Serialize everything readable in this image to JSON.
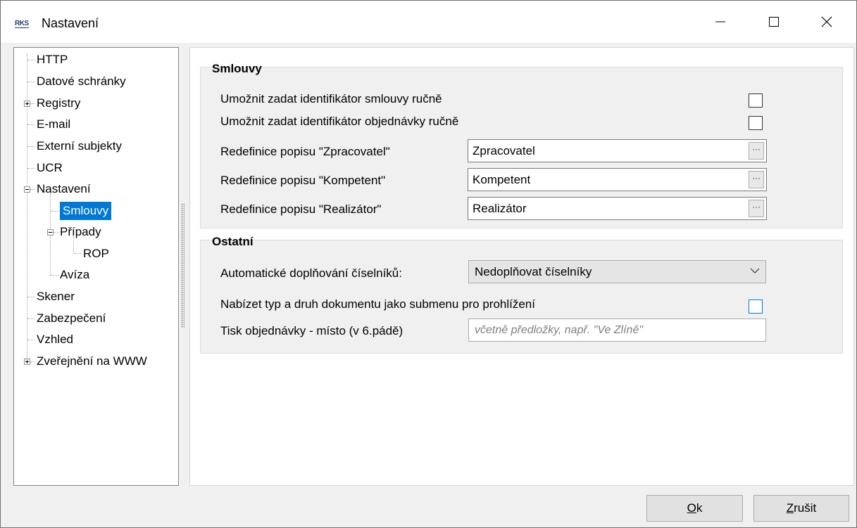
{
  "window": {
    "logo_text": "RKS",
    "title": "Nastavení",
    "minimize_label": "—",
    "maximize_label": "☐",
    "close_label": "✕"
  },
  "tree": {
    "items": [
      {
        "label": "HTTP"
      },
      {
        "label": "Datové schránky"
      },
      {
        "label": "Registry"
      },
      {
        "label": "E-mail"
      },
      {
        "label": "Externí subjekty"
      },
      {
        "label": "UCR"
      },
      {
        "label": "Nastavení"
      },
      {
        "label": "Smlouvy"
      },
      {
        "label": "Případy"
      },
      {
        "label": "ROP"
      },
      {
        "label": "Avíza"
      },
      {
        "label": "Skener"
      },
      {
        "label": "Zabezpečení"
      },
      {
        "label": "Vzhled"
      },
      {
        "label": "Zveřejnění na WWW"
      }
    ],
    "selected": "Smlouvy"
  },
  "smlouvy": {
    "title": "Smlouvy",
    "allow_contract_id_label": "Umožnit zadat identifikátor smlouvy ručně",
    "allow_contract_id_checked": false,
    "allow_order_id_label": "Umožnit zadat identifikátor objednávky ručně",
    "allow_order_id_checked": false,
    "zpracovatel_label": "Redefinice popisu \"Zpracovatel\"",
    "zpracovatel_value": "Zpracovatel",
    "kompetent_label": "Redefinice popisu \"Kompetent\"",
    "kompetent_value": "Kompetent",
    "realizator_label": "Redefinice popisu \"Realizátor\"",
    "realizator_value": "Realizátor",
    "ellipsis": "···"
  },
  "ostatni": {
    "title": "Ostatní",
    "auto_fill_label": "Automatické doplňování číselníků:",
    "auto_fill_value": "Nedoplňovat číselníky",
    "submenu_label": "Nabízet typ a druh dokumentu jako submenu pro prohlížení",
    "submenu_checked": false,
    "print_place_label": "Tisk objednávky - místo (v 6.pádě)",
    "print_place_placeholder": "včetně předložky, např. \"Ve Zlíně\""
  },
  "buttons": {
    "ok_first": "O",
    "ok_rest": "k",
    "cancel_first": "Z",
    "cancel_rest": "rušit"
  }
}
